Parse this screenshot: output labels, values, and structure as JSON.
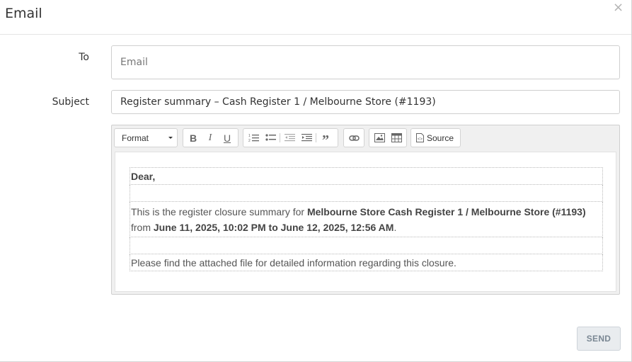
{
  "header": {
    "title": "Email",
    "close_label": "×"
  },
  "form": {
    "to_label": "To",
    "to_placeholder": "Email",
    "to_value": "",
    "subject_label": "Subject",
    "subject_value": "Register summary – Cash Register 1 / Melbourne Store (#1193)"
  },
  "toolbar": {
    "format_label": "Format",
    "source_label": "Source",
    "buttons": [
      "bold-icon",
      "italic-icon",
      "underline-icon",
      "numbered-list-icon",
      "bulleted-list-icon",
      "outdent-icon",
      "indent-icon",
      "blockquote-icon",
      "link-icon",
      "image-icon",
      "table-icon",
      "source-icon"
    ]
  },
  "body": {
    "greeting": "Dear,",
    "intro": "This is the  register closure summary for ",
    "store_name": "Melbourne Store Cash Register 1 / Melbourne Store (#1193)",
    "from_word": "from ",
    "date_range": "June 11, 2025, 10:02 PM to June 12, 2025, 12:56 AM",
    "period": ".",
    "attachment_note": "Please find the attached file for detailed information regarding this closure."
  },
  "footer": {
    "send_label": "SEND"
  },
  "colors": {
    "send_bg": "#e9ecef",
    "send_text": "#7a8793",
    "border": "#cfcfcf"
  }
}
